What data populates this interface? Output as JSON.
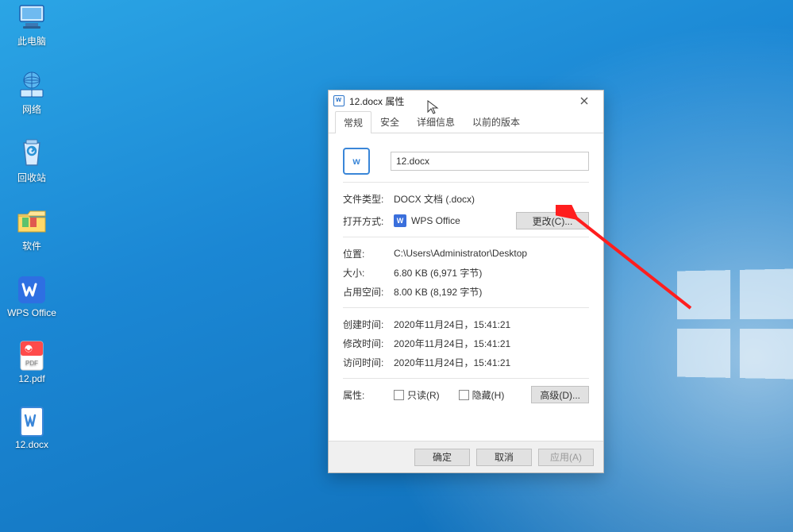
{
  "desktop": {
    "icons": [
      {
        "name": "computer",
        "label": "此电脑"
      },
      {
        "name": "network",
        "label": "网络"
      },
      {
        "name": "recyclebin",
        "label": "回收站"
      },
      {
        "name": "software",
        "label": "软件"
      },
      {
        "name": "wpsoffice",
        "label": "WPS Office"
      },
      {
        "name": "pdf12",
        "label": "12.pdf"
      },
      {
        "name": "docx12",
        "label": "12.docx"
      }
    ]
  },
  "dialog": {
    "title": "12.docx 属性",
    "tabs": {
      "general": "常规",
      "security": "安全",
      "details": "详细信息",
      "previous": "以前的版本"
    },
    "filename": "12.docx",
    "labels": {
      "filetype": "文件类型:",
      "openwith": "打开方式:",
      "location": "位置:",
      "size": "大小:",
      "disksize": "占用空间:",
      "created": "创建时间:",
      "modified": "修改时间:",
      "accessed": "访问时间:",
      "attributes": "属性:"
    },
    "values": {
      "filetype": "DOCX 文档 (.docx)",
      "openwithapp": "WPS Office",
      "location": "C:\\Users\\Administrator\\Desktop",
      "size": "6.80 KB (6,971 字节)",
      "disksize": "8.00 KB (8,192 字节)",
      "created": "2020年11月24日，15:41:21",
      "modified": "2020年11月24日，15:41:21",
      "accessed": "2020年11月24日，15:41:21"
    },
    "checkbox": {
      "readonly": "只读(R)",
      "hidden": "隐藏(H)"
    },
    "buttons": {
      "change": "更改(C)...",
      "advanced": "高级(D)...",
      "ok": "确定",
      "cancel": "取消",
      "apply": "应用(A)"
    }
  },
  "icon_glyphs": {
    "file_icon_text": "w",
    "wps_icon_text": "W"
  }
}
